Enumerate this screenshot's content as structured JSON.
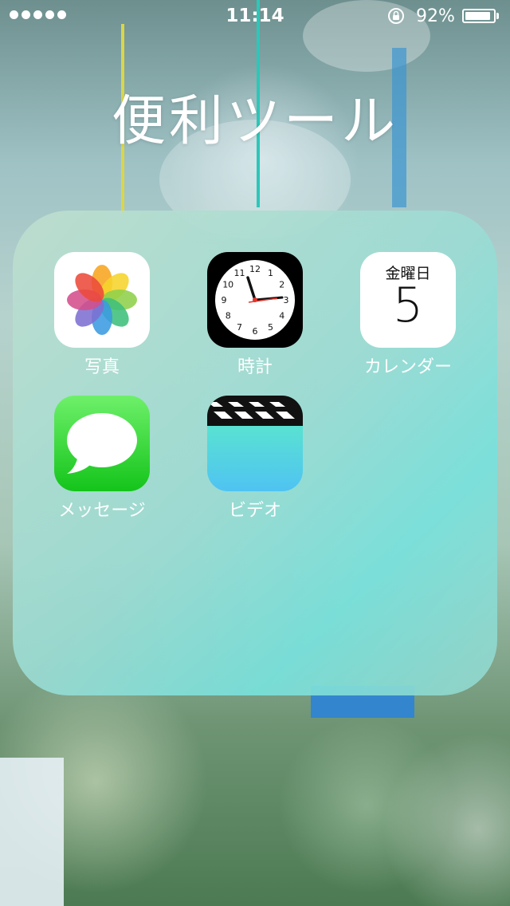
{
  "status_bar": {
    "signal_dots": 5,
    "time": "11:14",
    "battery_percent_label": "92%",
    "battery_level": 0.92
  },
  "folder": {
    "title": "便利ツール",
    "apps": [
      {
        "id": "photos",
        "label": "写真",
        "icon": "photos-icon"
      },
      {
        "id": "clock",
        "label": "時計",
        "icon": "clock-icon"
      },
      {
        "id": "calendar",
        "label": "カレンダー",
        "icon": "calendar-icon",
        "weekday": "金曜日",
        "date": "5"
      },
      {
        "id": "messages",
        "label": "メッセージ",
        "icon": "messages-icon"
      },
      {
        "id": "videos",
        "label": "ビデオ",
        "icon": "videos-icon"
      }
    ]
  },
  "clock_face": {
    "numbers": [
      "12",
      "1",
      "2",
      "3",
      "4",
      "5",
      "6",
      "7",
      "8",
      "9",
      "10",
      "11"
    ]
  },
  "colors": {
    "messages_green": "#14c41a",
    "videos_cyan": "#4fc3f2",
    "clock_second_hand": "#e2342a"
  }
}
